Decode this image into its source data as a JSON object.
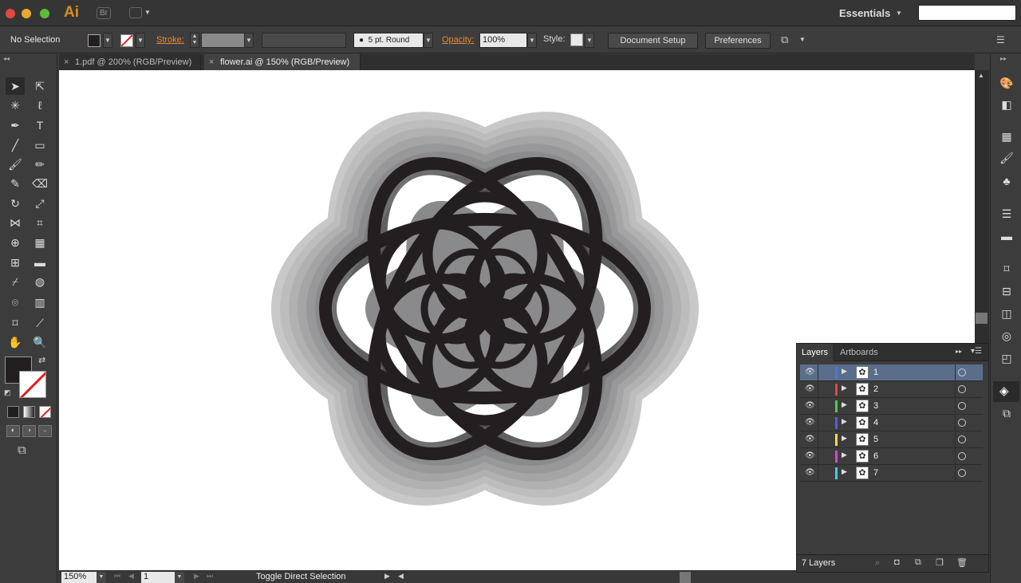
{
  "app": {
    "logo": "Ai",
    "bridge": "Br",
    "workspace": "Essentials"
  },
  "control": {
    "selection": "No Selection",
    "stroke_label": "Stroke:",
    "brush": "5 pt. Round",
    "opacity_label": "Opacity:",
    "opacity_value": "100%",
    "style_label": "Style:",
    "document_setup": "Document Setup",
    "preferences": "Preferences"
  },
  "tabs": [
    {
      "label": "1.pdf @ 200% (RGB/Preview)",
      "active": false
    },
    {
      "label": "flower.ai @ 150% (RGB/Preview)",
      "active": true
    }
  ],
  "status": {
    "zoom": "150%",
    "artboard": "1",
    "message": "Toggle Direct Selection"
  },
  "layers_panel": {
    "tabs": [
      "Layers",
      "Artboards"
    ],
    "count_label": "7 Layers",
    "layers": [
      {
        "name": "1",
        "color": "#4a78e0",
        "selected": true
      },
      {
        "name": "2",
        "color": "#e04848",
        "selected": false
      },
      {
        "name": "3",
        "color": "#48d048",
        "selected": false
      },
      {
        "name": "4",
        "color": "#5a5ae8",
        "selected": false
      },
      {
        "name": "5",
        "color": "#e8e048",
        "selected": false
      },
      {
        "name": "6",
        "color": "#d048d0",
        "selected": false
      },
      {
        "name": "7",
        "color": "#40d0d8",
        "selected": false
      }
    ]
  },
  "artwork": {
    "ring_colors": [
      "#c8c8c9",
      "#bdbdbe",
      "#b1b1b2",
      "#a5a5a6",
      "#98989a",
      "#8b8b8d",
      "#7d7d7f",
      "#6f6f71",
      "#606062",
      "#515153",
      "#434345"
    ],
    "line_color": "#231f20"
  }
}
